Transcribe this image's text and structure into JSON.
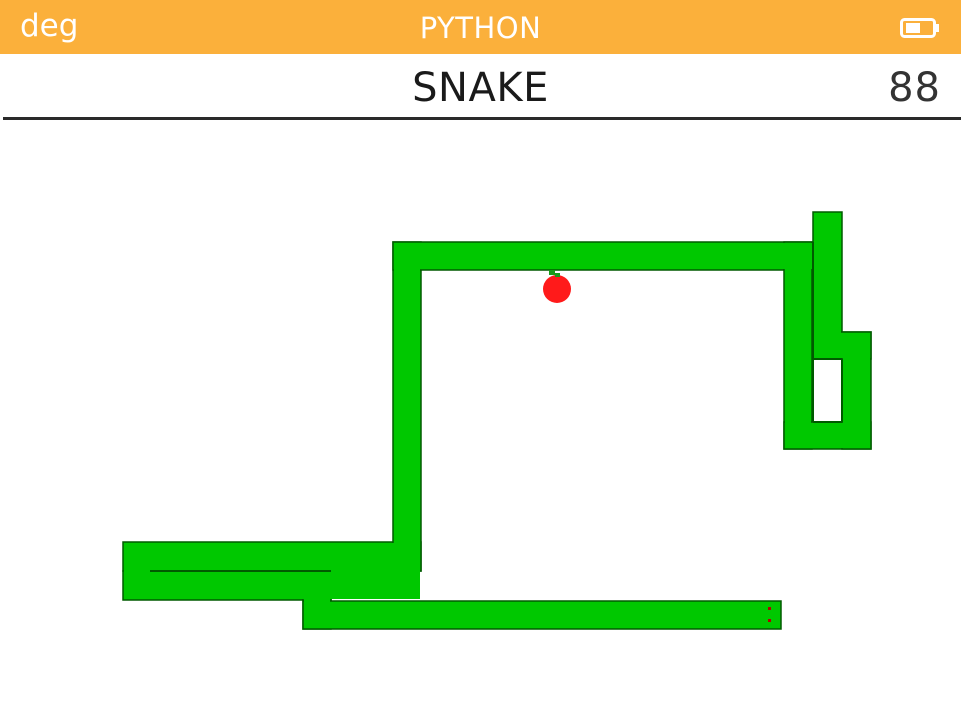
{
  "status_bar": {
    "angle_mode": "deg",
    "app_name": "PYTHON",
    "background_color": "#fbb03b",
    "battery_icon": "battery-icon"
  },
  "game": {
    "title": "SNAKE",
    "score": "88",
    "snake_color": "#00c800",
    "snake_outline_color": "#005a00",
    "apple_color": "#ff1a1a",
    "apple_icon": "apple-icon"
  }
}
